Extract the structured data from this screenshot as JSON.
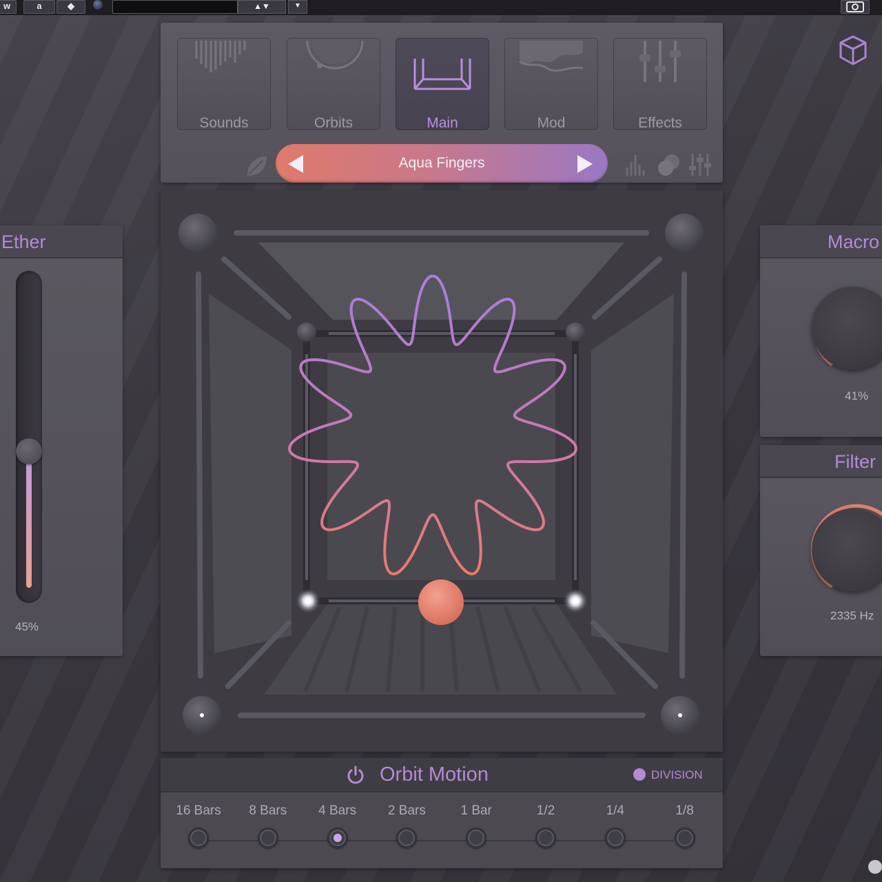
{
  "host": {
    "buttons": [
      "w",
      "a",
      "◆"
    ],
    "arrows": "▲▼",
    "dropdown": "▼"
  },
  "tabs": [
    {
      "label": "Sounds",
      "icon": "sounds-icon",
      "active": false
    },
    {
      "label": "Orbits",
      "icon": "orbits-icon",
      "active": false
    },
    {
      "label": "Main",
      "icon": "main-icon",
      "active": true
    },
    {
      "label": "Mod",
      "icon": "mod-icon",
      "active": false
    },
    {
      "label": "Effects",
      "icon": "effects-icon",
      "active": false
    }
  ],
  "preset": {
    "name": "Aqua Fingers",
    "prev_icon": "triangle-left-icon",
    "next_icon": "triangle-right-icon"
  },
  "ether": {
    "title": "Ether",
    "value_label": "45%",
    "value_fraction": 0.45
  },
  "macro": {
    "title": "Macro",
    "value_label": "41%",
    "value_fraction": 0.41
  },
  "filter": {
    "title": "Filter",
    "value_label": "2335 Hz"
  },
  "orbit_motion": {
    "title": "Orbit Motion",
    "division_label": "DIVISION",
    "divisions": [
      "16 Bars",
      "8 Bars",
      "4 Bars",
      "2 Bars",
      "1 Bar",
      "1/2",
      "1/4",
      "1/8"
    ],
    "selected_index": 2
  },
  "colors": {
    "accent": "#b58ad8",
    "gradient_start": "#e07a6a",
    "gradient_end": "#9a78c4",
    "orb": "#e8816c"
  }
}
